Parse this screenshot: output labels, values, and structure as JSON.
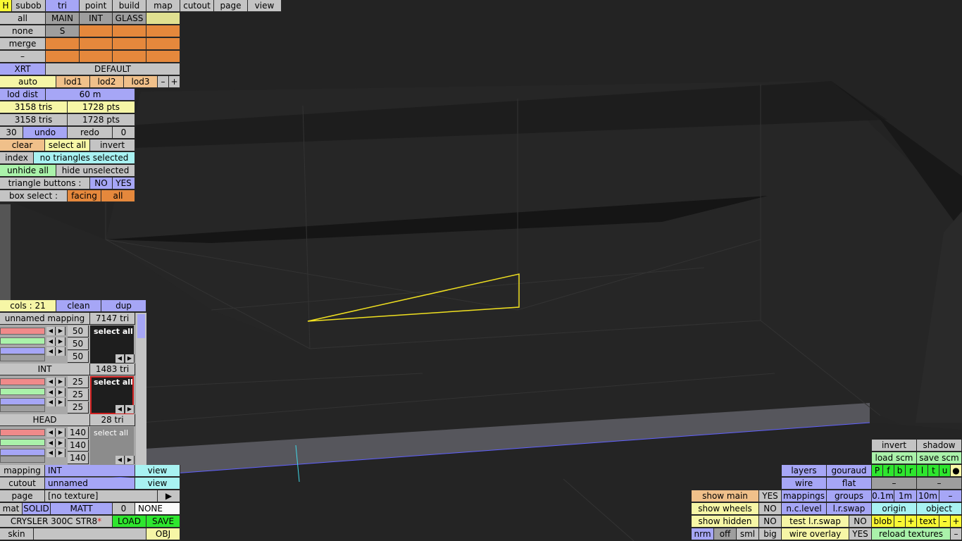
{
  "top_menu": {
    "h": "H",
    "items": [
      "subob",
      "tri",
      "point",
      "build",
      "map",
      "cutout",
      "page",
      "view"
    ]
  },
  "filter": {
    "all": "all",
    "main": "MAIN",
    "int": "INT",
    "glass": "GLASS",
    "none": "none",
    "s": "S",
    "merge": "merge",
    "minus": "–"
  },
  "xrt": {
    "xrt": "XRT",
    "default": "DEFAULT"
  },
  "lod": {
    "auto": "auto",
    "lod1": "lod1",
    "lod2": "lod2",
    "lod3": "lod3",
    "minus": "–",
    "plus": "+",
    "dist_label": "lod dist",
    "dist_value": "60 m"
  },
  "stats": {
    "tris1": "3158 tris",
    "pts1": "1728 pts",
    "tris2": "3158 tris",
    "pts2": "1728 pts"
  },
  "history": {
    "count": "30",
    "undo": "undo",
    "redo": "redo",
    "redo_count": "0"
  },
  "selection": {
    "clear": "clear",
    "select_all": "select all",
    "invert": "invert",
    "index": "index",
    "status": "no triangles selected",
    "unhide_all": "unhide all",
    "hide_unselected": "hide unselected",
    "tri_buttons_label": "triangle buttons :",
    "no": "NO",
    "yes": "YES",
    "box_select_label": "box select :",
    "facing": "facing",
    "all": "all"
  },
  "colors": {
    "header": "cols : 21",
    "clean": "clean",
    "dup": "dup",
    "groups": [
      {
        "name": "unnamed mapping",
        "tris": "7147 tri",
        "vals": [
          "50",
          "50",
          "50"
        ],
        "sel": "select all"
      },
      {
        "name": "INT",
        "tris": "1483 tri",
        "vals": [
          "25",
          "25",
          "25"
        ],
        "sel": "select all"
      },
      {
        "name": "HEAD",
        "tris": "28 tri",
        "vals": [
          "140",
          "140",
          "140"
        ],
        "sel": "select all"
      }
    ],
    "arrow_left": "◀",
    "arrow_right": "▶"
  },
  "bottom_left": {
    "mapping_label": "mapping",
    "mapping_value": "INT",
    "view": "view",
    "cutout_label": "cutout",
    "cutout_value": "unnamed",
    "page_label": "page",
    "page_value": "[no texture]",
    "page_arrow": "▶",
    "mat": "mat",
    "solid": "SOLID",
    "matt": "MATT",
    "zero": "0",
    "none": "NONE",
    "car_name": "CRYSLER 300C STR8",
    "star": "*",
    "load": "LOAD",
    "save": "SAVE",
    "skin": "skin",
    "obj": "OBJ"
  },
  "bottom_right": {
    "show_main": "show main",
    "show_wheels": "show wheels",
    "show_hidden": "show hidden",
    "yes": "YES",
    "no": "NO",
    "nrm": "nrm",
    "off": "off",
    "sml": "sml",
    "big": "big",
    "layers": "layers",
    "gouraud": "gouraud",
    "wire": "wire",
    "flat": "flat",
    "mappings": "mappings",
    "groups": "groups",
    "nc_level": "n.c.level",
    "lr_swap": "l.r.swap",
    "test_lr_swap": "test l.r.swap",
    "wire_overlay": "wire overlay",
    "invert": "invert",
    "shadow": "shadow",
    "load_scm": "load scm",
    "save_scm": "save scm",
    "flags": [
      "P",
      "f",
      "b",
      "r",
      "l",
      "t",
      "u",
      "●"
    ],
    "dash": "–",
    "d01": "0.1m",
    "d1": "1m",
    "d10": "10m",
    "origin": "origin",
    "object": "object",
    "blob": "blob",
    "text": "text",
    "minus": "–",
    "plus": "+",
    "reload": "reload textures"
  },
  "accent_colors": {
    "selection_outline": "#f0e020",
    "cyan_line": "#40d8e8",
    "blue_line": "#6060ff"
  }
}
